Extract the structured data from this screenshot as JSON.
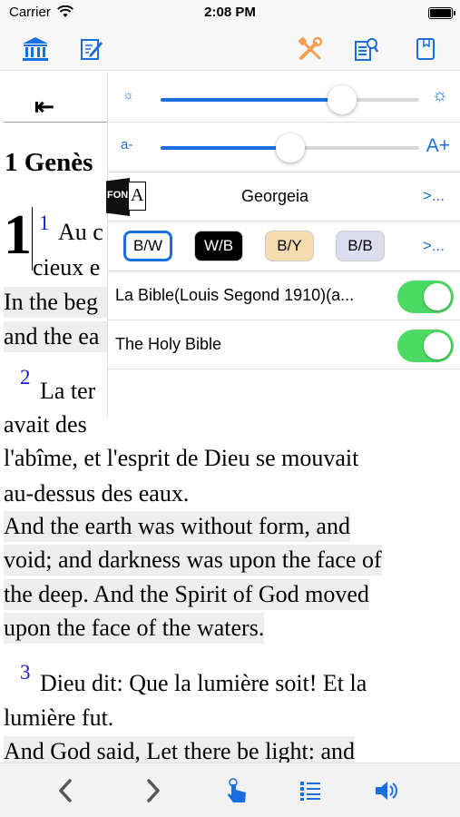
{
  "status": {
    "carrier": "Carrier",
    "time": "2:08 PM"
  },
  "toolbar": {
    "left_icons": [
      "bank-icon",
      "edit-icon"
    ],
    "right_icons": [
      "tools-icon",
      "search-settings-icon",
      "bookmark-icon"
    ]
  },
  "reader": {
    "back_arrow": "⇤",
    "book_title": "1 Genès",
    "chapter_number": "1",
    "verses": [
      {
        "num": "1",
        "lines": [
          "Au c",
          "cieux e"
        ],
        "en": [
          "In the beg",
          "and the ea"
        ]
      },
      {
        "num": "2",
        "lines": [
          "La ter",
          "avait des",
          "l'abîme, et l'esprit de Dieu se mouvait",
          "au-dessus des eaux."
        ],
        "en": [
          "And the earth was without form, and",
          "void; and darkness was upon the face of",
          "the deep. And the Spirit of God moved",
          "upon the face of the waters."
        ]
      },
      {
        "num": "3",
        "lines": [
          "Dieu dit: Que la lumière soit! Et la",
          "lumière fut."
        ],
        "en": [
          "And God said, Let there be light: and"
        ]
      }
    ]
  },
  "settings_panel": {
    "brightness": {
      "min_icon": "☼",
      "max_icon": "☼",
      "value": 0.7
    },
    "font_size": {
      "min_label": "a-",
      "max_label": "A+",
      "value": 0.5
    },
    "font": {
      "icon_label": "FON",
      "icon_letter": "A",
      "name": "Georgeia",
      "more": ">..."
    },
    "themes": {
      "buttons": [
        {
          "label": "B/W",
          "bg": "#ffffff",
          "fg": "#000000",
          "selected": true
        },
        {
          "label": "W/B",
          "bg": "#000000",
          "fg": "#ffffff",
          "selected": false
        },
        {
          "label": "B/Y",
          "bg": "#f5dbb0",
          "fg": "#000000",
          "selected": false
        },
        {
          "label": "B/B",
          "bg": "#dcdcef",
          "fg": "#000000",
          "selected": false
        }
      ],
      "more": ">..."
    },
    "bibles": [
      {
        "label": "La Bible(Louis Segond 1910)(a...",
        "enabled": true
      },
      {
        "label": "The Holy Bible",
        "enabled": true
      }
    ]
  },
  "bottombar": {
    "icons": [
      "chevron-left-icon",
      "chevron-right-icon",
      "tap-icon",
      "list-icon",
      "speaker-icon"
    ]
  },
  "colors": {
    "accent": "#1a6fe0",
    "verse_number": "#1a1ad6",
    "toggle_on": "#4cd964",
    "tool_orange": "#f0a050"
  }
}
